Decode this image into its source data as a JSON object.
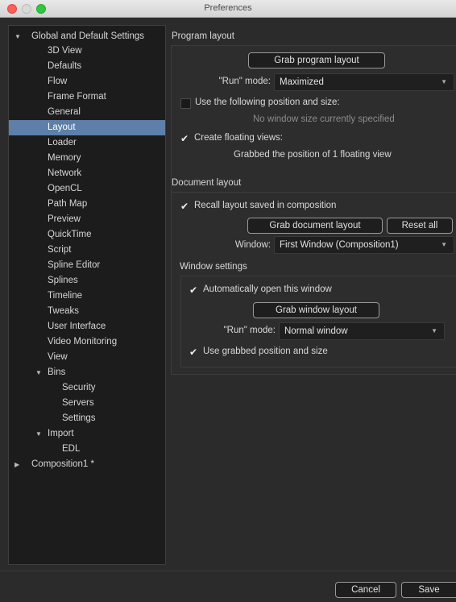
{
  "window": {
    "title": "Preferences"
  },
  "sidebar": {
    "root": "Global and Default Settings",
    "items": [
      "3D View",
      "Defaults",
      "Flow",
      "Frame Format",
      "General",
      "Layout",
      "Loader",
      "Memory",
      "Network",
      "OpenCL",
      "Path Map",
      "Preview",
      "QuickTime",
      "Script",
      "Spline Editor",
      "Splines",
      "Timeline",
      "Tweaks",
      "User Interface",
      "Video Monitoring",
      "View"
    ],
    "bins": {
      "label": "Bins",
      "children": [
        "Security",
        "Servers",
        "Settings"
      ]
    },
    "import": {
      "label": "Import",
      "children": [
        "EDL"
      ]
    },
    "composition": "Composition1 *",
    "selected": "Layout"
  },
  "program_layout": {
    "heading": "Program layout",
    "grab_button": "Grab program layout",
    "run_mode_label": "\"Run\" mode:",
    "run_mode_value": "Maximized",
    "use_position_label": "Use the following position and size:",
    "use_position_checked": false,
    "no_window_text": "No window size currently specified",
    "floating_label": "Create floating views:",
    "floating_checked": true,
    "grabbed_text": "Grabbed the position of 1 floating view"
  },
  "document_layout": {
    "heading": "Document layout",
    "recall_label": "Recall layout saved in composition",
    "recall_checked": true,
    "grab_button": "Grab document layout",
    "reset_button": "Reset all",
    "window_label": "Window:",
    "window_value": "First Window (Composition1)"
  },
  "window_settings": {
    "heading": "Window settings",
    "auto_open_label": "Automatically open this window",
    "auto_open_checked": true,
    "grab_button": "Grab window layout",
    "run_mode_label": "\"Run\" mode:",
    "run_mode_value": "Normal window",
    "use_grabbed_label": "Use grabbed position and size",
    "use_grabbed_checked": true
  },
  "footer": {
    "cancel": "Cancel",
    "save": "Save"
  },
  "icons": {
    "check": "checkmark-icon",
    "expand": "triangle-down-icon",
    "collapse": "triangle-right-icon",
    "dropdown": "chevron-down-icon"
  },
  "colors": {
    "selection": "#5d7fa8",
    "close": "#fc5f57",
    "maximize": "#2fc840"
  }
}
